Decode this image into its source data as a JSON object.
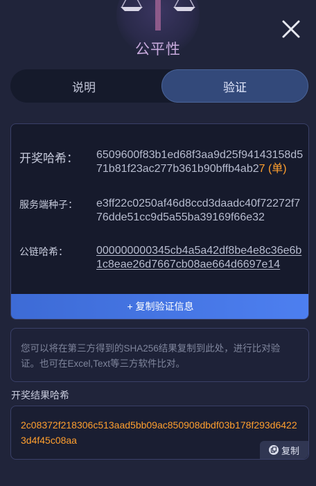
{
  "header": {
    "title": "公平性",
    "icon": "scales-emblem-icon"
  },
  "tabs": [
    {
      "label": "说明",
      "active": false
    },
    {
      "label": "验证",
      "active": true
    }
  ],
  "verification": {
    "draw_hash": {
      "label": "开奖哈希：",
      "value_prefix": "6509600f83b1ed68f3aa9d25f94143158d571b81f23ac277b361b90bffb4ab2",
      "highlight": "7 (单)"
    },
    "server_seed": {
      "label": "服务端种子：",
      "value": "e3ff22c0250af46d8ccd3daadc40f72272f776dde51cc9d5a55ba39169f66e32"
    },
    "chain_hash": {
      "label": "公链哈希：",
      "value": "000000000345cb4a5a42df8be4e8c36e6b1c8eae26d7667cb08ae664d6697e14"
    },
    "copy_button": "+ 复制验证信息"
  },
  "note": "您可以将在第三方得到的SHA256结果复制到此处，进行比对验证。也可在Excel,Text等三方软件比对。",
  "result": {
    "label": "开奖结果哈希",
    "value": "2c08372f218306c513aad5bb09ac850908dbdf03b178f293d64223d4f45c08aa",
    "copy_label": "复制"
  },
  "colors": {
    "background": "#20243a",
    "accent_orange": "#ff9f2e",
    "button_blue": "#4d7ff0",
    "title_purple": "#c7a9dc"
  }
}
